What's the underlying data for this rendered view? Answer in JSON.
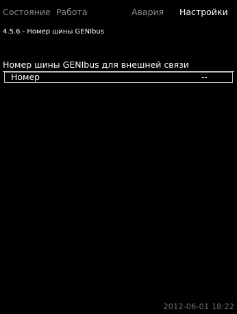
{
  "tabs": [
    {
      "label": "Состояние",
      "active": false
    },
    {
      "label": "Работа",
      "active": false
    },
    {
      "label": "Авария",
      "active": false
    },
    {
      "label": "Настройки",
      "active": true
    }
  ],
  "menu_id": "4.5.6 - Номер шины GENIbus",
  "section_title": "Номер шины GENIbus для внешней связи",
  "rows": [
    {
      "label": "Номер",
      "value": "--"
    }
  ],
  "datetime": "2012-06-01 18:22",
  "colors": {
    "background": "#000000",
    "text": "#ffffff",
    "inactive_tab": "#8a8a8a",
    "datetime": "#6f6f6f"
  }
}
